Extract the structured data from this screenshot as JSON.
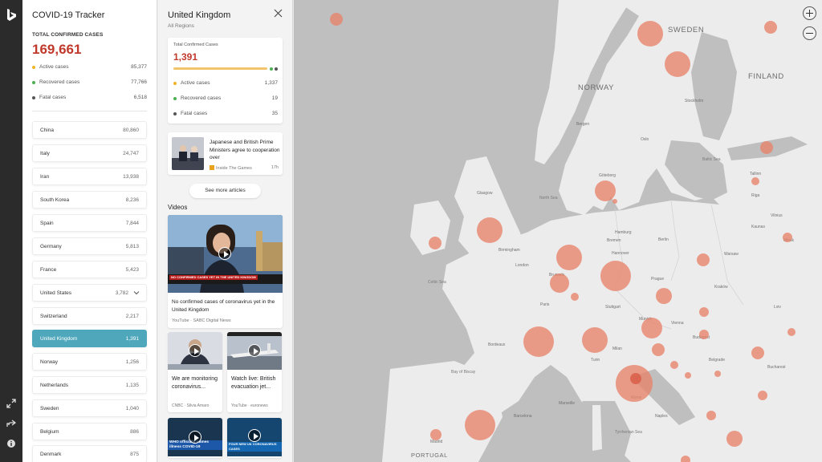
{
  "tracker": {
    "title": "COVID-19 Tracker",
    "total_label": "TOTAL CONFIRMED CASES",
    "total_value": "169,661",
    "active_label": "Active cases",
    "active_value": "85,377",
    "recovered_label": "Recovered cases",
    "recovered_value": "77,766",
    "fatal_label": "Fatal cases",
    "fatal_value": "6,518",
    "countries": [
      {
        "name": "China",
        "value": "80,860"
      },
      {
        "name": "Italy",
        "value": "24,747"
      },
      {
        "name": "Iran",
        "value": "13,938"
      },
      {
        "name": "South Korea",
        "value": "8,236"
      },
      {
        "name": "Spain",
        "value": "7,844"
      },
      {
        "name": "Germany",
        "value": "5,813"
      },
      {
        "name": "France",
        "value": "5,423"
      },
      {
        "name": "United States",
        "value": "3,782"
      },
      {
        "name": "Switzerland",
        "value": "2,217"
      },
      {
        "name": "United Kingdom",
        "value": "1,391"
      },
      {
        "name": "Norway",
        "value": "1,256"
      },
      {
        "name": "Netherlands",
        "value": "1,135"
      },
      {
        "name": "Sweden",
        "value": "1,040"
      },
      {
        "name": "Belgium",
        "value": "886"
      },
      {
        "name": "Denmark",
        "value": "875"
      }
    ]
  },
  "region": {
    "title": "United Kingdom",
    "subtitle": "All Regions",
    "total_label": "Total Confirmed Cases",
    "total_value": "1,391",
    "active_label": "Active cases",
    "active_value": "1,337",
    "recovered_label": "Recovered cases",
    "recovered_value": "19",
    "fatal_label": "Fatal cases",
    "fatal_value": "35",
    "news": {
      "headline": "Japanese and British Prime Ministers agree to cooperation over",
      "source": "Inside The Games",
      "age": "17h"
    },
    "see_more": "See more articles",
    "videos_heading": "Videos",
    "videos": [
      {
        "title": "No confirmed cases of coronavirus yet in the United Kingdom",
        "source": "YouTube · SABC Digital News",
        "overlay": "NO CONFIRMED CASES YET IN THE UNITED KINGDOM"
      },
      {
        "title": "We are monitoring coronavirus...",
        "source": "CNBC · Silvia Amaro"
      },
      {
        "title": "Watch live: British evacuation jet...",
        "source": "YouTube · euronews"
      },
      {
        "overlay": "WHO officially names illness COVID-19"
      },
      {
        "overlay": "FOUR NEW UK CORONAVIRUS CASES"
      }
    ]
  },
  "map": {
    "countries": [
      "SWEDEN",
      "NORWAY",
      "FINLAND"
    ],
    "cities": [
      "Bergen",
      "Oslo",
      "Stockholm",
      "Göteborg",
      "Tallinn",
      "Riga",
      "Glasgow",
      "Birmingham",
      "London",
      "Hamburg",
      "Berlin",
      "Bremen",
      "Hannover",
      "Warsaw",
      "Kraków",
      "Brussels",
      "Paris",
      "Stuttgart",
      "Munich",
      "Vienna",
      "Prague",
      "Milan",
      "Turin",
      "Naples",
      "Rome",
      "Budapest",
      "Belgrade",
      "Bucharest",
      "Lviv",
      "Minsk",
      "Vilnius",
      "Kaunas",
      "Marseille",
      "Bordeaux",
      "Madrid",
      "Barcelona"
    ],
    "seas": [
      "North Sea",
      "Baltic Sea",
      "Celtic Sea",
      "Tyrrhenian Sea",
      "Bay of Biscay"
    ],
    "other": [
      "PORTUGAL"
    ],
    "colors": {
      "water": "#bfbfbf",
      "land": "#ececec",
      "bubble": "#e8836a"
    }
  }
}
